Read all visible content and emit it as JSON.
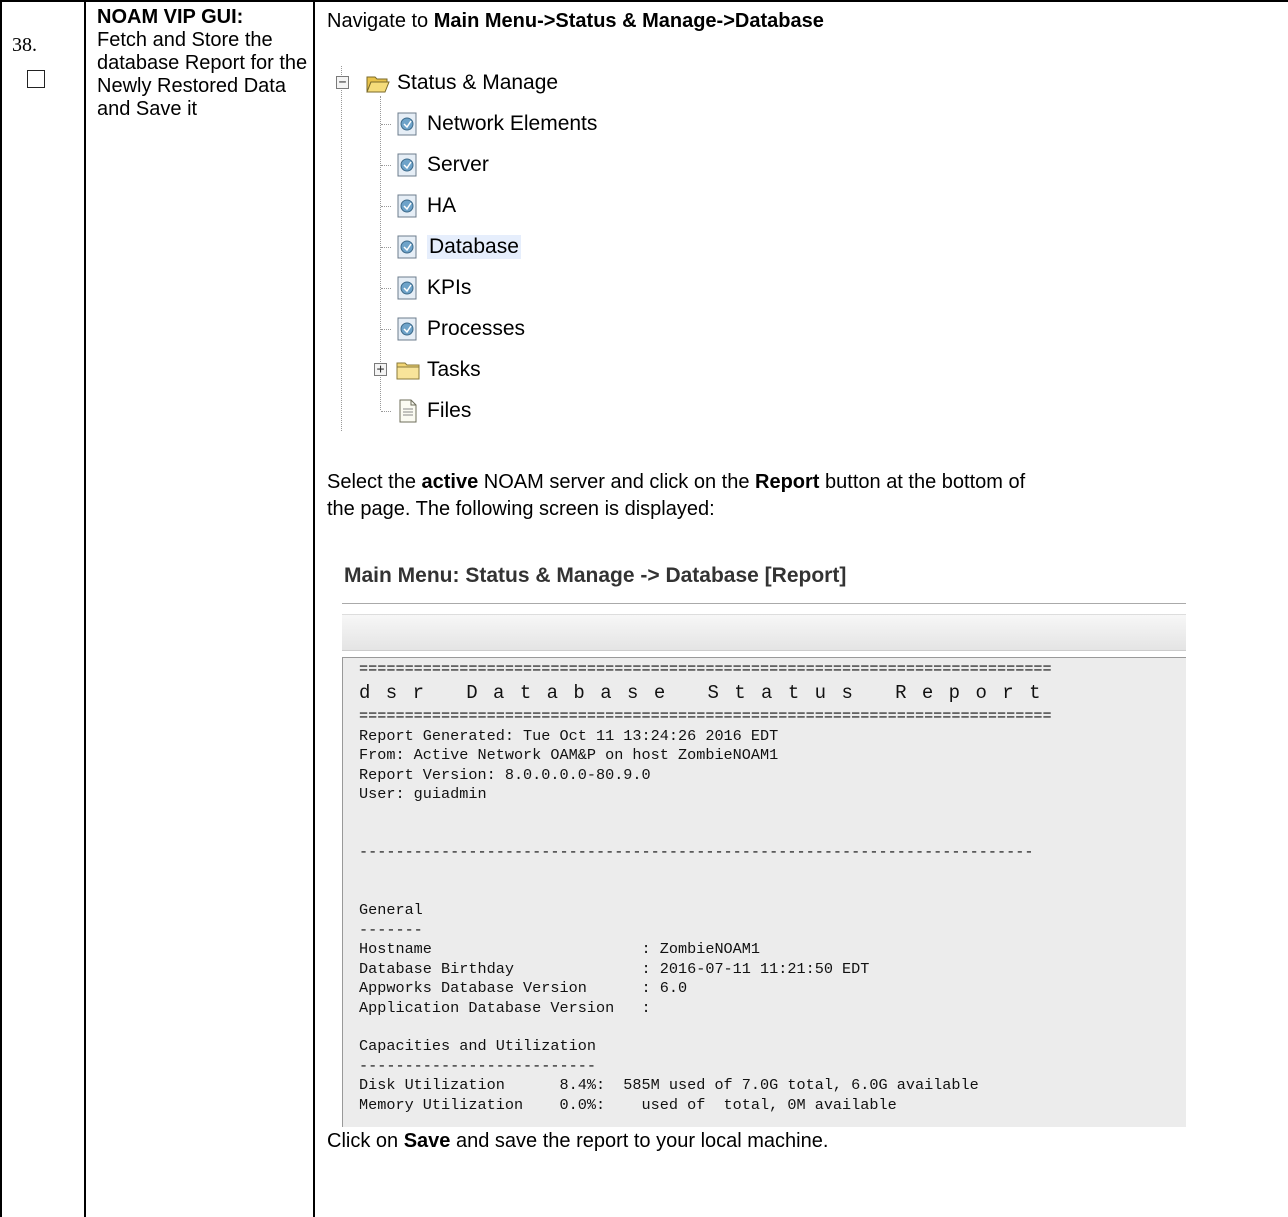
{
  "step": {
    "number": "38.",
    "title_bold": "NOAM VIP GUI:",
    "title_text": "Fetch and Store the database Report for the Newly Restored Data and Save it"
  },
  "instructions": {
    "nav_prefix": "Navigate to ",
    "nav_path": "Main Menu->Status & Manage->Database",
    "select_prefix": "Select the ",
    "select_bold": "active",
    "select_mid": " NOAM server and click on the ",
    "select_button": "Report",
    "select_suffix": " button at the bottom of",
    "select_line2": "the page. The following screen is displayed:",
    "save_prefix": "Click on ",
    "save_bold": "Save",
    "save_suffix": " and save the report to your local machine."
  },
  "tree": {
    "root_label": "Status & Manage",
    "root_expander": "−",
    "items": [
      {
        "label": "Network Elements",
        "icon": "status-page-icon"
      },
      {
        "label": "Server",
        "icon": "status-page-icon"
      },
      {
        "label": "HA",
        "icon": "status-page-icon"
      },
      {
        "label": "Database",
        "icon": "status-page-icon"
      },
      {
        "label": "KPIs",
        "icon": "status-page-icon"
      },
      {
        "label": "Processes",
        "icon": "status-page-icon"
      }
    ],
    "tasks_label": "Tasks",
    "tasks_expander": "+",
    "files_label": "Files"
  },
  "screen": {
    "title": "Main Menu: Status & Manage -> Database [Report]",
    "report": {
      "separator": "============================================================================",
      "heading": "d s r   D a t a b a s e   S t a t u s   R e p o r t",
      "generated": "Report Generated: Tue Oct 11 13:24:26 2016 EDT",
      "from": "From: Active Network OAM&P on host ZombieNOAM1",
      "version": "Report Version: 8.0.0.0.0-80.9.0",
      "user": "User: guiadmin",
      "dash_line": "--------------------------------------------------------------------------",
      "general": "General",
      "general_underline": "-------",
      "hostname": "Hostname                       : ZombieNOAM1",
      "birthday": "Database Birthday              : 2016-07-11 11:21:50 EDT",
      "appworks": "Appworks Database Version      : 6.0",
      "appdb": "Application Database Version   :",
      "capacities": "Capacities and Utilization",
      "cap_underline": "--------------------------",
      "disk": "Disk Utilization      8.4%:  585M used of 7.0G total, 6.0G available",
      "memory": "Memory Utilization    0.0%:    used of  total, 0M available"
    }
  }
}
